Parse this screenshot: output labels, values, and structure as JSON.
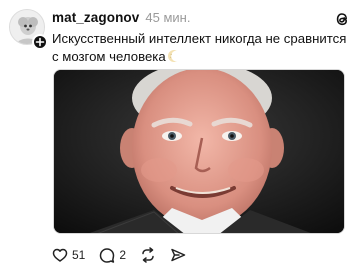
{
  "post": {
    "username": "mat_zagonov",
    "timestamp": "45 мин.",
    "text": "Искусственный интеллект никогда не сравнится с мозгом человека",
    "text_emoji": "waning-crescent-moon-emoji"
  },
  "icons": {
    "app_logo": "threads-icon",
    "badge": "plus-icon",
    "like": "heart-icon",
    "reply": "speech-bubble-icon",
    "repost": "repost-arrows-icon",
    "share": "send-icon"
  },
  "actions": {
    "likes_count": "51",
    "replies_count": "2"
  },
  "colors": {
    "text": "#111111",
    "muted": "#9a9a9a",
    "background": "#ffffff"
  }
}
